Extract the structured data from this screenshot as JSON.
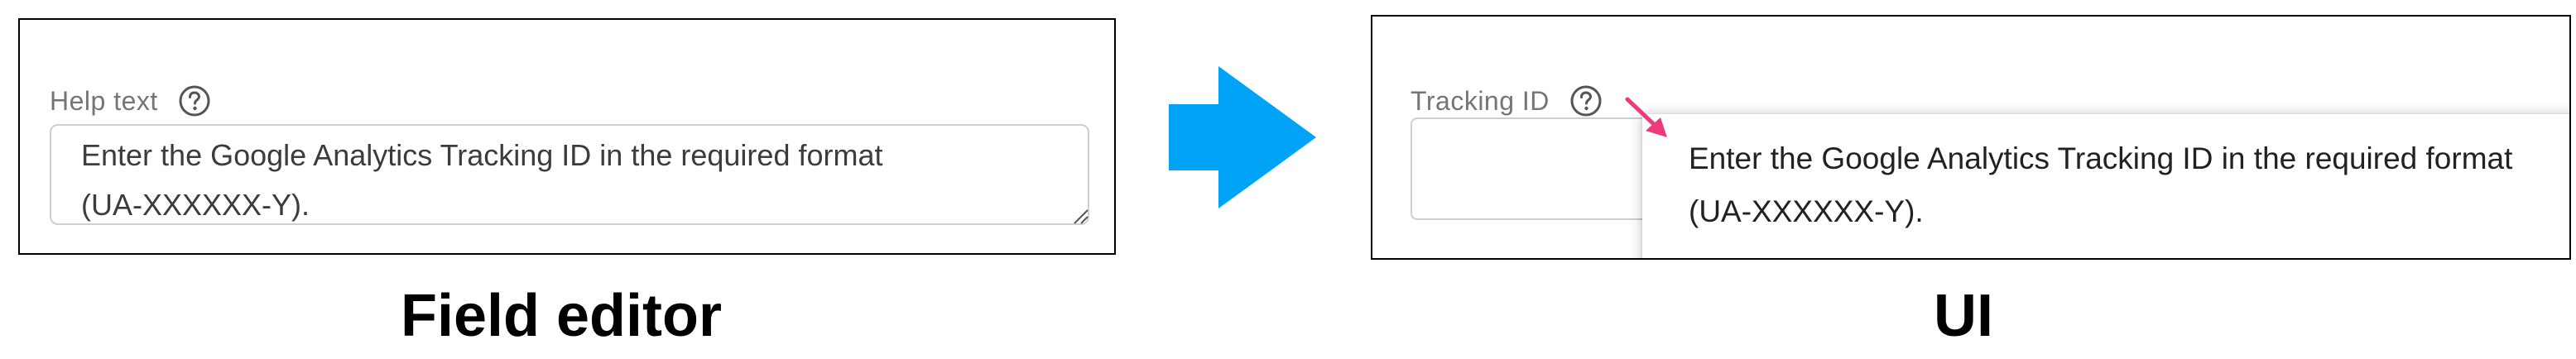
{
  "field_editor": {
    "label": "Help text",
    "help_icon": "question-circle-icon",
    "textarea_value": "Enter the Google Analytics Tracking ID in the required format\n(UA-XXXXXX-Y).",
    "caption": "Field editor"
  },
  "transition": {
    "icon": "arrow-right-icon",
    "color": "#00a3f5"
  },
  "ui": {
    "label": "Tracking ID",
    "help_icon": "question-circle-icon",
    "input_value": "",
    "tooltip_text": "Enter the Google Analytics Tracking ID in the required format\n(UA-XXXXXX-Y).",
    "pointer_color": "#ec3b7a",
    "caption": "UI"
  }
}
